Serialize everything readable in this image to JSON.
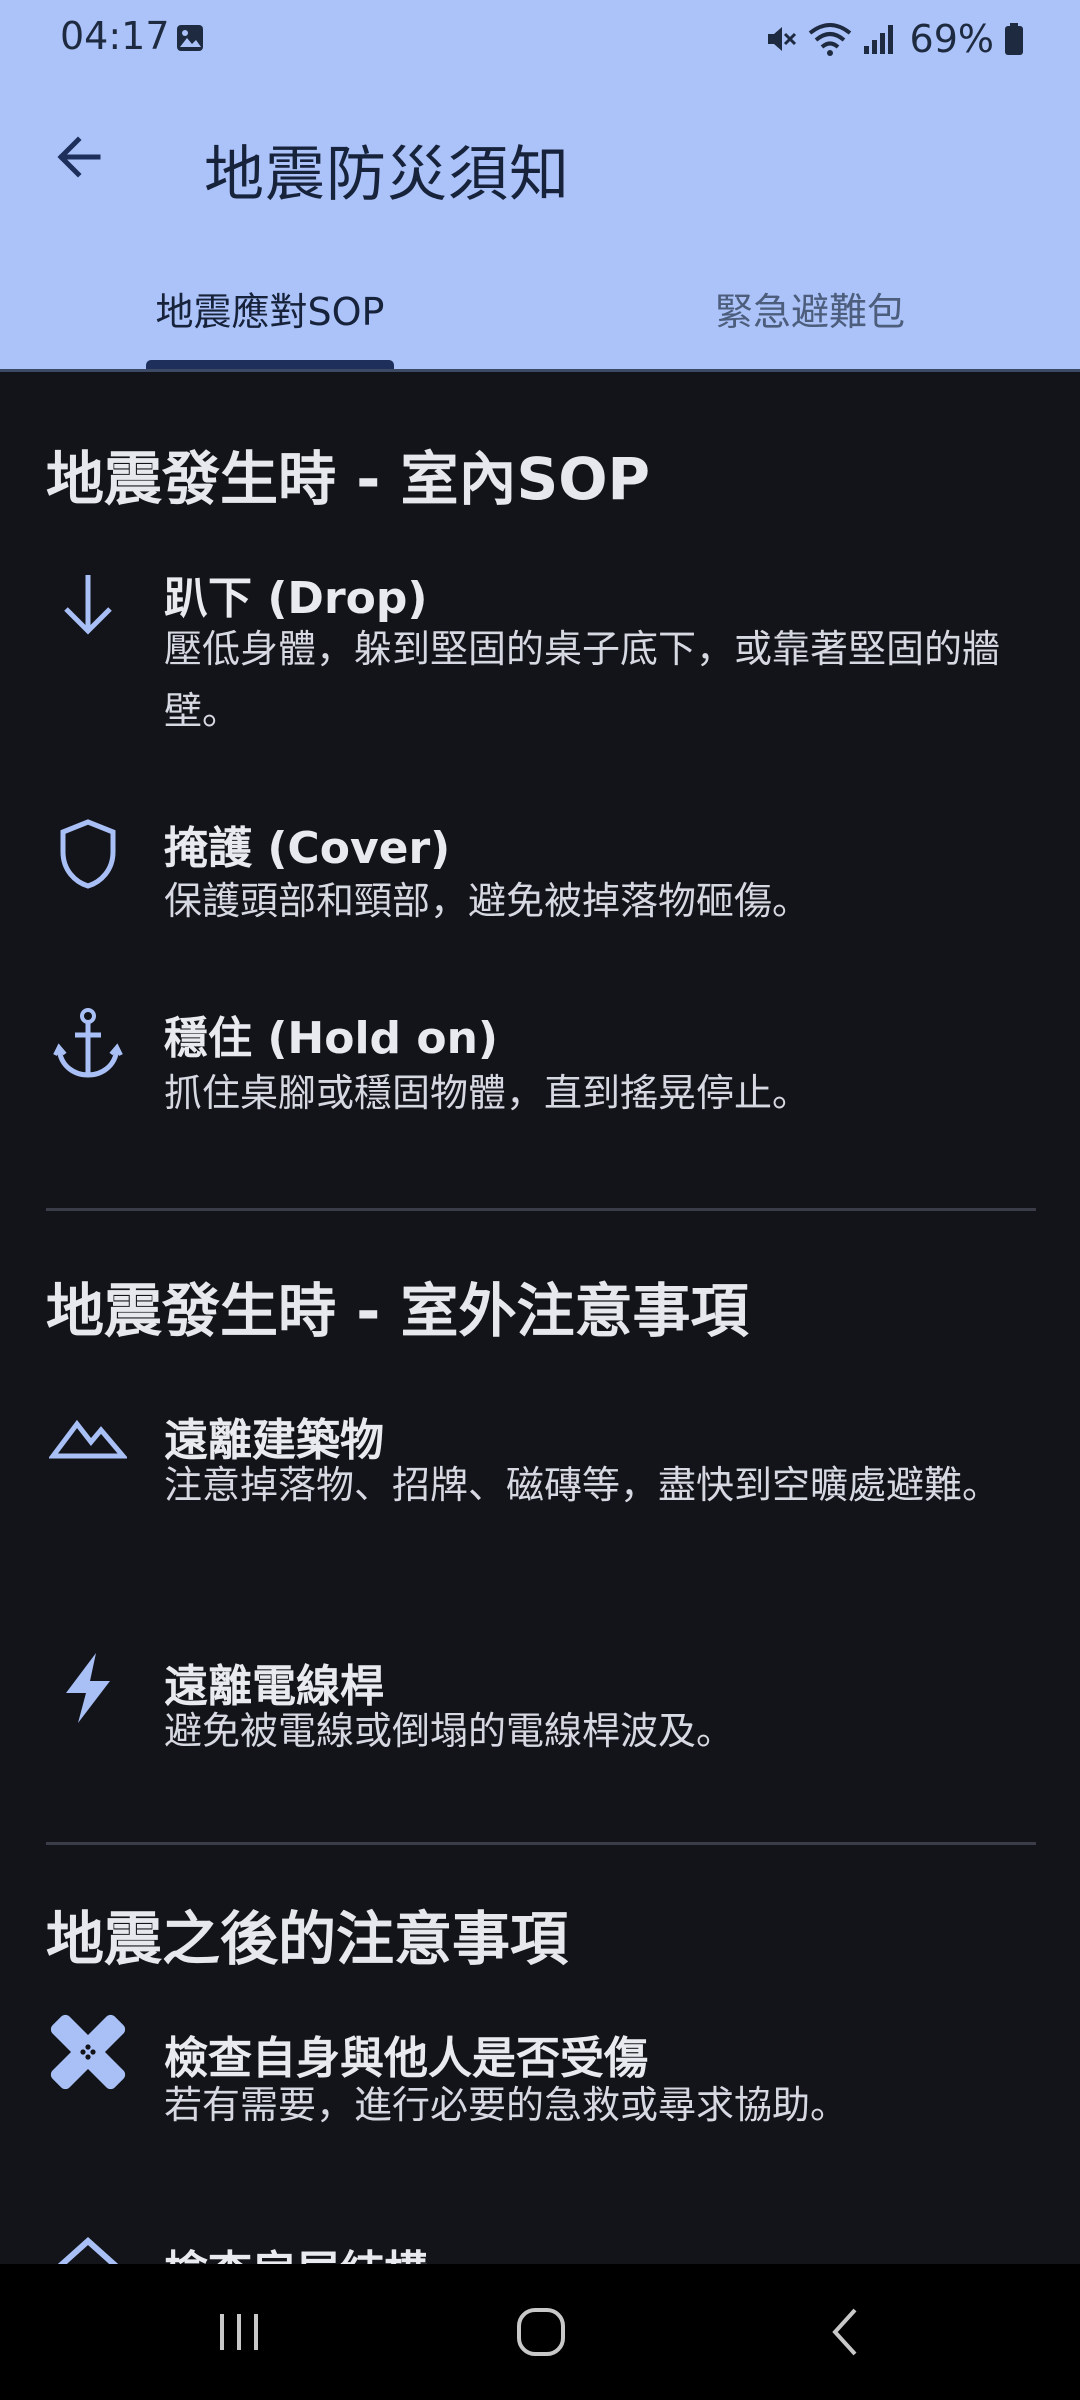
{
  "status_bar": {
    "time": "04:17",
    "battery": "69%"
  },
  "app_bar": {
    "title": "地震防災須知"
  },
  "tabs": [
    {
      "label": "地震應對SOP",
      "selected": true
    },
    {
      "label": "緊急避難包",
      "selected": false
    }
  ],
  "sections": [
    {
      "title": "地震發生時 - 室內SOP",
      "items": [
        {
          "icon": "arrow-down-icon",
          "title": "趴下 (Drop)",
          "desc": "壓低身體，躲到堅固的桌子底下，或靠著堅固的牆壁。"
        },
        {
          "icon": "shield-icon",
          "title": "掩護 (Cover)",
          "desc": "保護頭部和頸部，避免被掉落物砸傷。"
        },
        {
          "icon": "anchor-icon",
          "title": "穩住 (Hold on)",
          "desc": "抓住桌腳或穩固物體，直到搖晃停止。"
        }
      ]
    },
    {
      "title": "地震發生時 - 室外注意事項",
      "items": [
        {
          "icon": "landscape-icon",
          "title": "遠離建築物",
          "desc": "注意掉落物、招牌、磁磚等，盡快到空曠處避難。"
        },
        {
          "icon": "lightning-bolt-icon",
          "title": "遠離電線桿",
          "desc": "避免被電線或倒塌的電線桿波及。"
        }
      ]
    },
    {
      "title": "地震之後的注意事項",
      "items": [
        {
          "icon": "bandage-icon",
          "title": "檢查自身與他人是否受傷",
          "desc": "若有需要，進行必要的急救或尋求協助。"
        },
        {
          "icon": "house-icon",
          "title": "檢查房屋結構",
          "desc": ""
        }
      ]
    }
  ],
  "colors": {
    "app_bar_bg": "#acc3fa",
    "content_bg": "#13141a",
    "icon_accent": "#a9c0f7",
    "tab_indicator": "#1e2f5c"
  }
}
